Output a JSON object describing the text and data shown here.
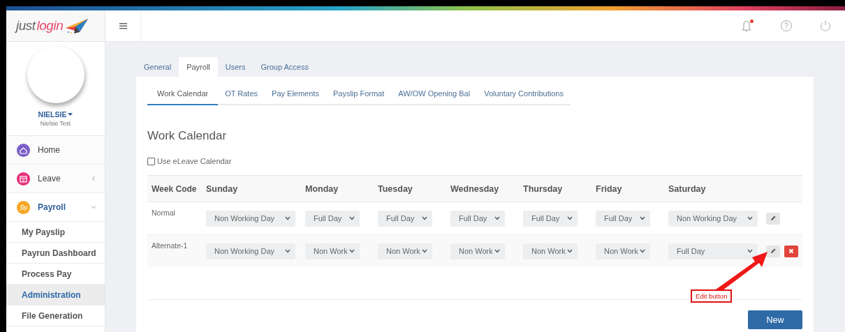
{
  "logo": {
    "text_1": "just",
    "text_2": "login"
  },
  "topbar": {
    "notifications_unread": true
  },
  "profile": {
    "username": "NIELSIE",
    "full_name": "Nielsie Test"
  },
  "sidebar": {
    "items": [
      {
        "label": "Home",
        "kind": "link",
        "color": "#7b5fc9"
      },
      {
        "label": "Leave",
        "kind": "group",
        "color": "#e8307a",
        "expanded": false
      },
      {
        "label": "Payroll",
        "kind": "group",
        "color": "#f5a623",
        "expanded": true,
        "children": [
          {
            "label": "My Payslip",
            "selected": false
          },
          {
            "label": "Payrun Dashboard",
            "selected": false
          },
          {
            "label": "Process Pay",
            "selected": false
          },
          {
            "label": "Administration",
            "selected": true
          },
          {
            "label": "File Generation",
            "selected": false
          }
        ]
      }
    ]
  },
  "tabs": [
    {
      "label": "General",
      "selected": false
    },
    {
      "label": "Payroll",
      "selected": true
    },
    {
      "label": "Users",
      "selected": false
    },
    {
      "label": "Group Access",
      "selected": false
    }
  ],
  "subtabs": [
    {
      "label": "Work Calendar",
      "selected": true
    },
    {
      "label": "OT Rates",
      "selected": false
    },
    {
      "label": "Pay Elements",
      "selected": false
    },
    {
      "label": "Payslip Format",
      "selected": false
    },
    {
      "label": "AW/OW Opening Bal",
      "selected": false
    },
    {
      "label": "Voluntary Contributions",
      "selected": false
    }
  ],
  "heading": "Work Calendar",
  "use_eleave_calendar": {
    "label": "Use eLeave Calendar",
    "checked": false
  },
  "table": {
    "columns": [
      "Week Code",
      "Sunday",
      "Monday",
      "Tuesday",
      "Wednesday",
      "Thursday",
      "Friday",
      "Saturday"
    ],
    "rows": [
      {
        "week_code": "Normal",
        "days": [
          "Non Working Day",
          "Full Day",
          "Full Day",
          "Full Day",
          "Full Day",
          "Full Day",
          "Non Working Day"
        ],
        "deletable": false
      },
      {
        "week_code": "Alternate-1",
        "days": [
          "Non Working Day",
          "Non Work",
          "Non Work",
          "Non Work",
          "Non Work",
          "Non Work",
          "Full Day"
        ],
        "deletable": true
      }
    ]
  },
  "new_button": "New",
  "annotation": {
    "text": "Edit button"
  }
}
